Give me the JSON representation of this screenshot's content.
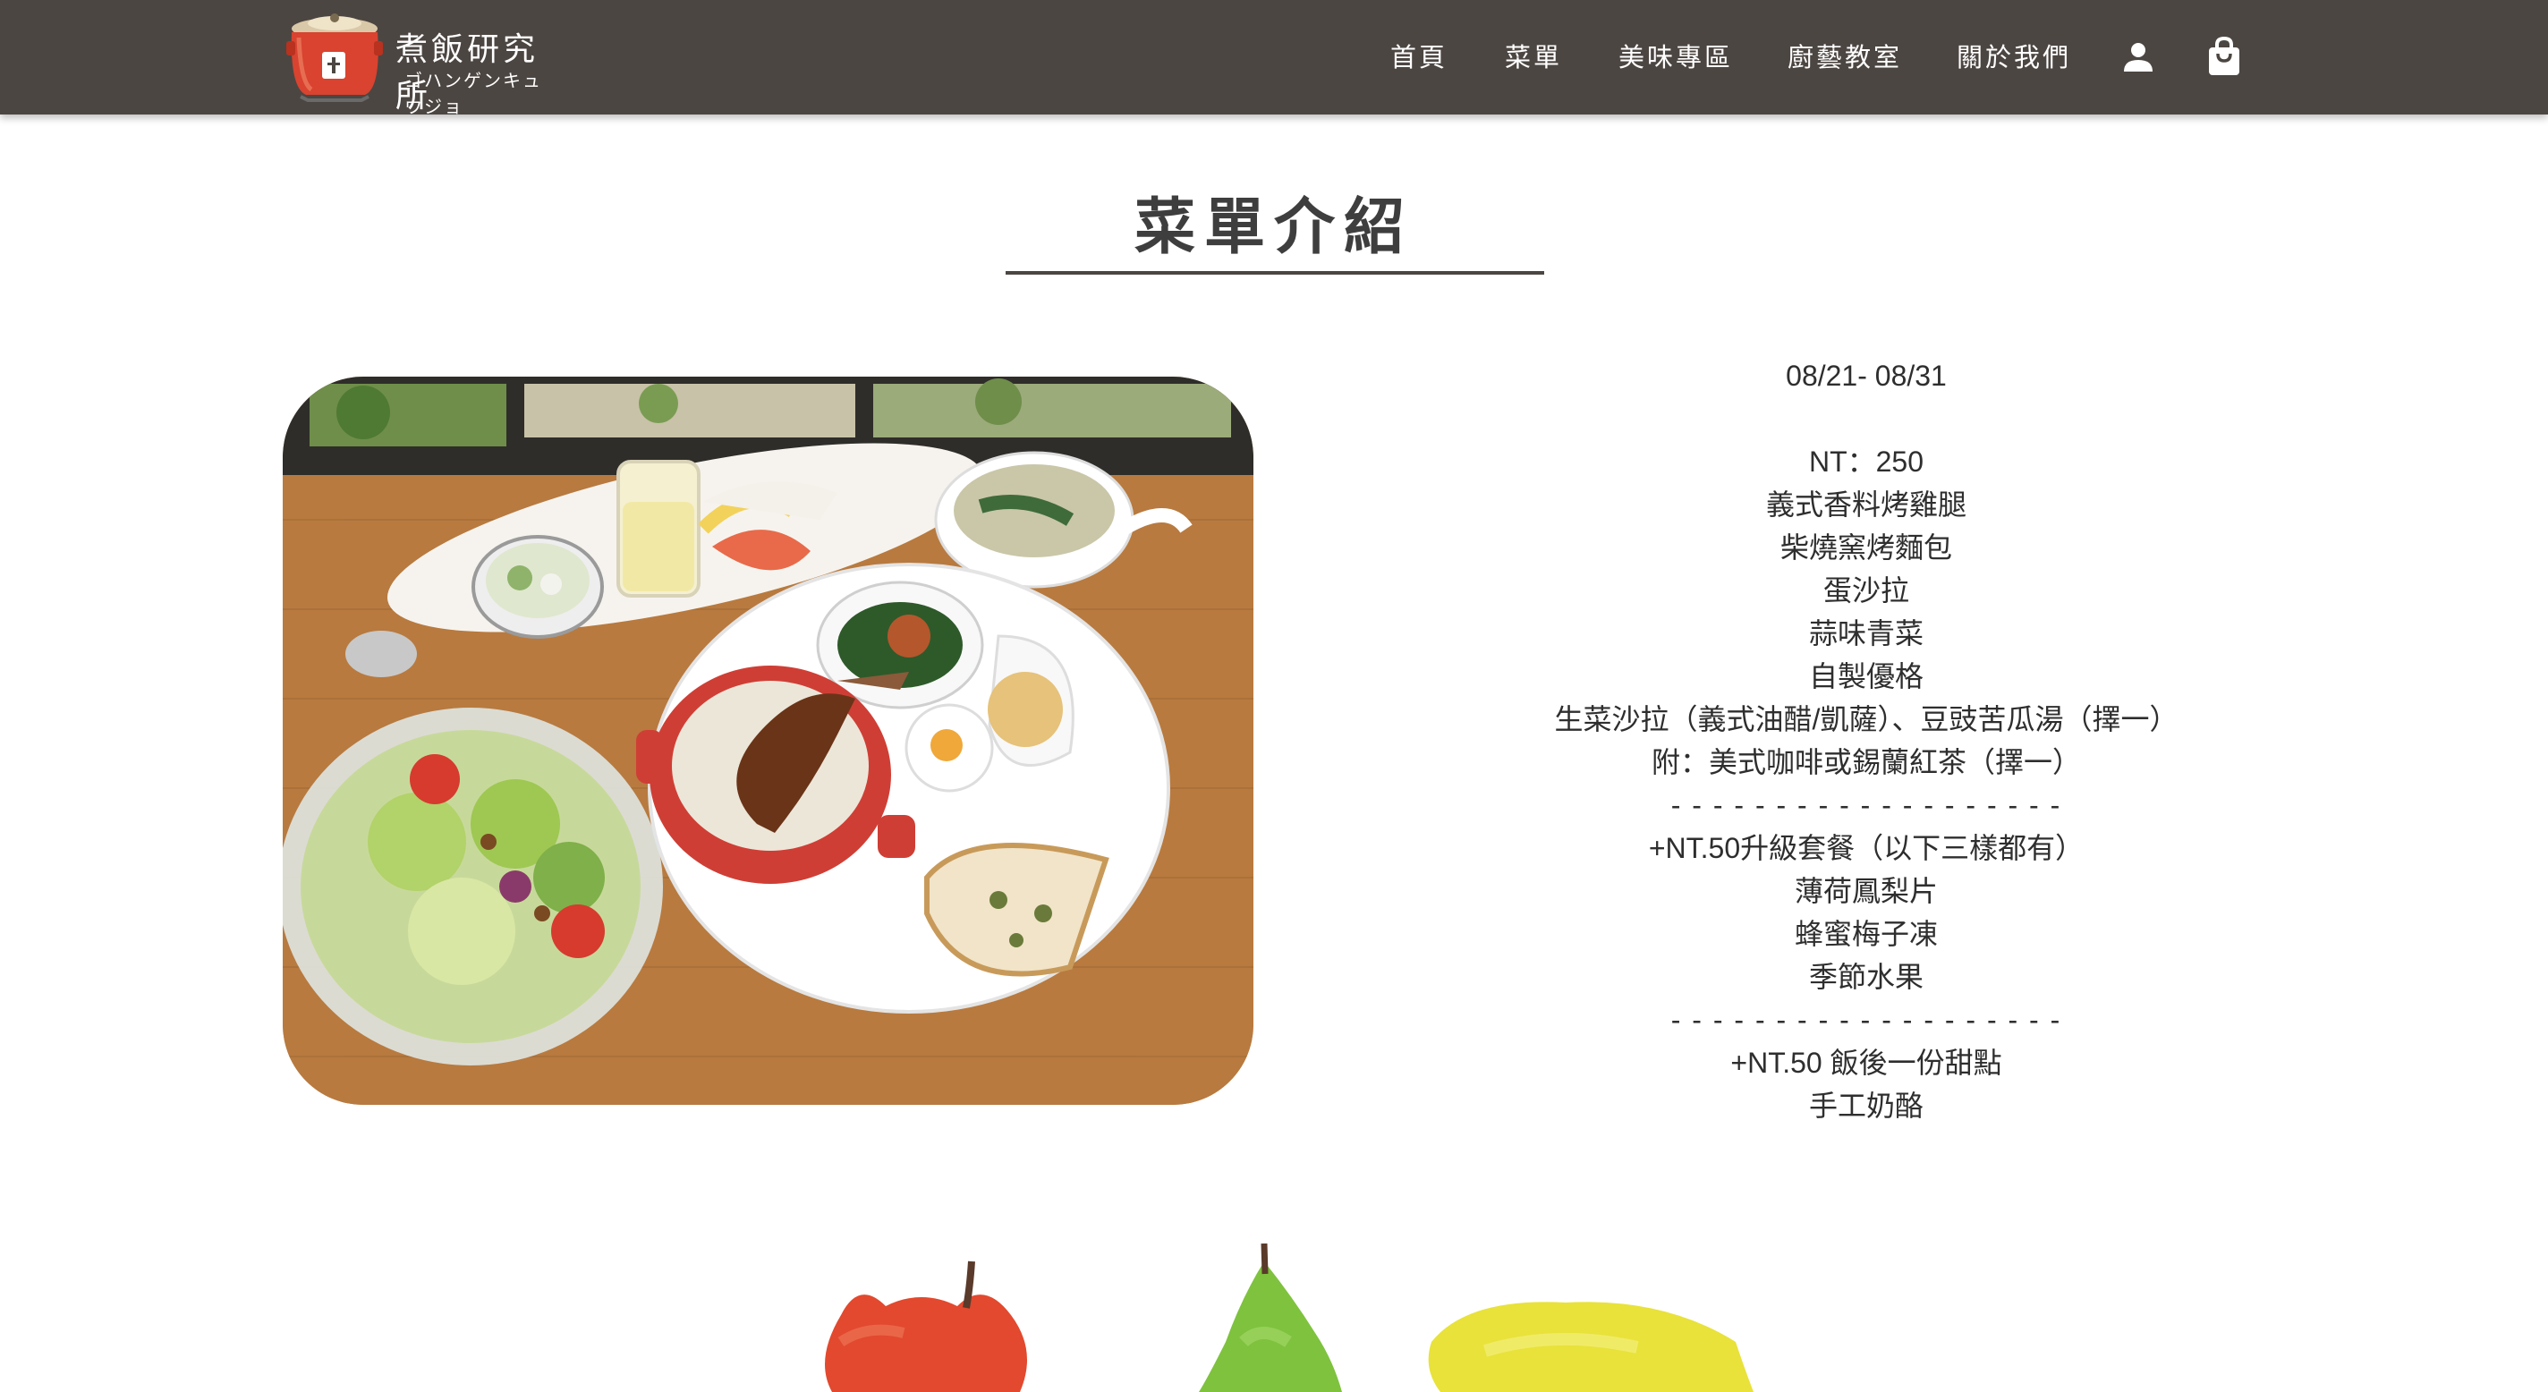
{
  "brand": {
    "name": "煮飯研究所",
    "kana": "ゴハンゲンキュウジョ"
  },
  "nav": {
    "items": [
      {
        "label": "首頁"
      },
      {
        "label": "菜單"
      },
      {
        "label": "美味專區"
      },
      {
        "label": "廚藝教室"
      },
      {
        "label": "關於我們"
      }
    ],
    "icons": [
      "user-icon",
      "shopping-bag-icon"
    ]
  },
  "page": {
    "title": "菜單介紹"
  },
  "menu": {
    "date_range": "08/21- 08/31",
    "price": "NT：250",
    "items": [
      "義式香料烤雞腿",
      "柴燒窯烤麵包",
      "蛋沙拉",
      "蒜味青菜",
      "自製優格",
      "生菜沙拉（義式油醋/凱薩）、豆豉苦瓜湯（擇一）",
      "附：美式咖啡或錫蘭紅茶（擇一）"
    ],
    "separator": "- - - - - - - - - - - - - - - - - - -",
    "upgrade_title": "+NT.50升級套餐（以下三樣都有）",
    "upgrade_items": [
      "薄荷鳳梨片",
      "蜂蜜梅子凍",
      "季節水果"
    ],
    "dessert_title": "+NT.50 飯後一份甜點",
    "dessert_items": [
      "手工奶酪"
    ]
  },
  "colors": {
    "navbar": "#4c4642",
    "title_text": "#3e3e3e",
    "body_text": "#2e2e2e",
    "apple": "#e2492e",
    "pear": "#7ec23e",
    "lemon": "#e8e23a"
  }
}
